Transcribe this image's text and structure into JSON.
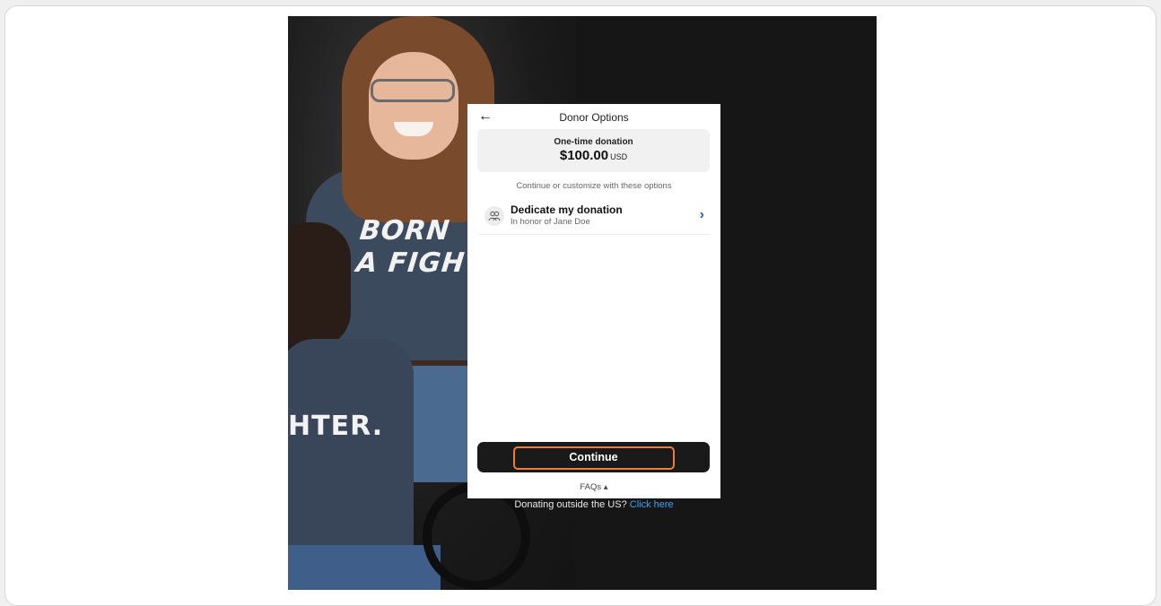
{
  "modal": {
    "title": "Donor Options",
    "back_icon": "arrow-left-icon",
    "summary": {
      "label": "One-time donation",
      "amount": "$100.00",
      "currency": "USD"
    },
    "options_hint": "Continue or customize with these options",
    "options": [
      {
        "title": "Dedicate my donation",
        "subtitle": "In honor of Jane Doe",
        "icon": "people-icon",
        "chevron": "chevron-right-icon"
      }
    ],
    "continue_label": "Continue",
    "faqs_label": "FAQs ▴"
  },
  "footer": {
    "outside_text": "Donating outside the US?",
    "outside_link": "Click here"
  },
  "background": {
    "shirt_text_line1": "BORN",
    "shirt_text_line2": "A FIGHTER.",
    "shirt2_text": "HTER."
  },
  "colors": {
    "accent_link": "#3ea0f3",
    "chevron": "#2b5db5",
    "focus_outline": "#f07c3a",
    "button_bg": "#1a1a1a",
    "shirt_green": "#9bd12f"
  }
}
